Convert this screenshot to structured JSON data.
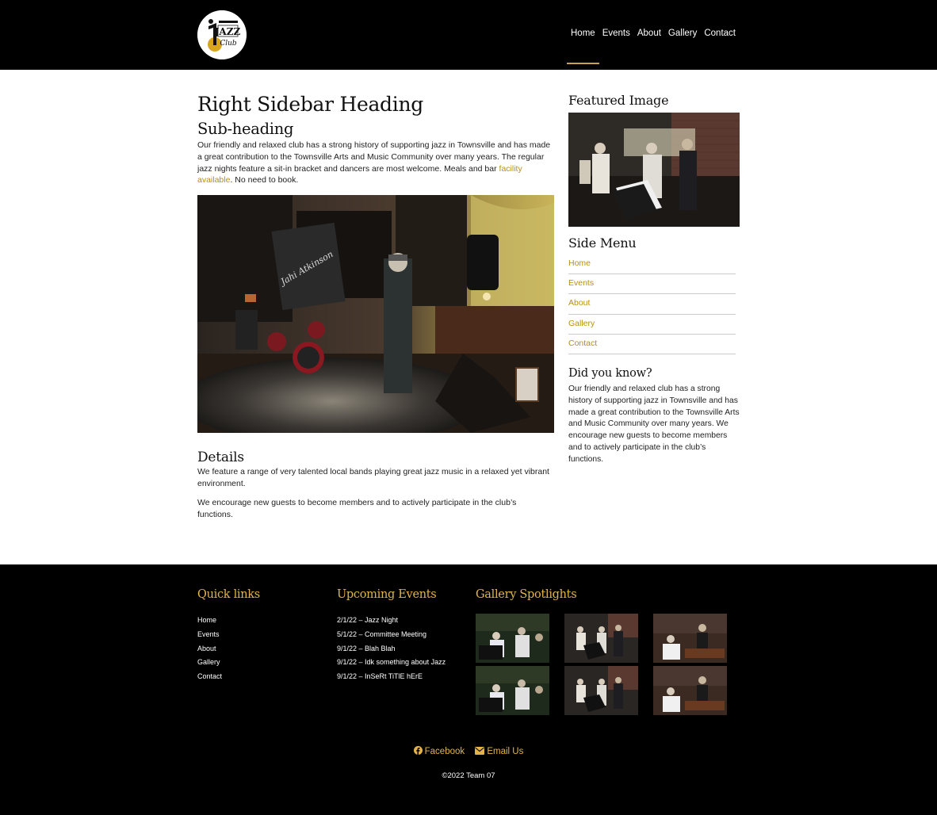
{
  "header": {
    "logo_alt": "Townsville Jazz Club",
    "nav": [
      {
        "label": "Home",
        "active": true
      },
      {
        "label": "Events"
      },
      {
        "label": "About"
      },
      {
        "label": "Gallery"
      },
      {
        "label": "Contact"
      }
    ]
  },
  "main": {
    "title": "Right Sidebar Heading",
    "subtitle": "Sub-heading",
    "intro_before_link": "Our friendly and relaxed club has a strong history of supporting jazz in Townsville and has made a great contribution to the Townsville Arts and Music Community over many years. The regular jazz nights feature a sit-in bracket and dancers are most welcome. Meals and bar ",
    "intro_link": "facility available",
    "intro_after_link": ". No need to book.",
    "details_heading": "Details",
    "details_p1": "We feature a range of very talented local bands playing great jazz music in a relaxed yet vibrant environment.",
    "details_p2": "We encourage new guests to become members and to actively participate in the club’s functions."
  },
  "sidebar": {
    "featured_heading": "Featured Image",
    "menu_heading": "Side Menu",
    "menu": [
      "Home",
      "Events",
      "About",
      "Gallery",
      "Contact"
    ],
    "did_you_know_heading": "Did you know?",
    "did_you_know_text": "Our friendly and relaxed club has a strong history of supporting jazz in Townsville and has made a great contribution to the Townsville Arts and Music Community over many years. We encourage new guests to become members and to actively participate in the club’s functions."
  },
  "footer": {
    "quick_links_heading": "Quick links",
    "quick_links": [
      "Home",
      "Events",
      "About",
      "Gallery",
      "Contact"
    ],
    "events_heading": "Upcoming Events",
    "events": [
      "2/1/22 – Jazz Night",
      "5/1/22 – Committee Meeting",
      "9/1/22 – Blah Blah",
      "9/1/22 – Idk something about Jazz",
      "9/1/22 – InSeRt TiTlE hErE"
    ],
    "gallery_heading": "Gallery Spotlights",
    "facebook_label": "Facebook",
    "email_label": "Email Us",
    "copyright": "©2022 Team 07"
  },
  "colors": {
    "accent_gold": "#b8900e",
    "footer_gold": "#e4b44a",
    "header_bg": "#000000"
  }
}
